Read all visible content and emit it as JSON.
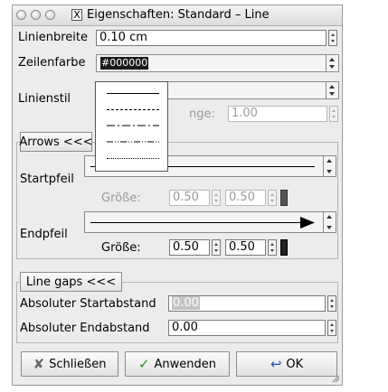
{
  "window": {
    "title": "Eigenschaften: Standard – Line",
    "window_icon_letter": "X"
  },
  "line": {
    "width_label": "Linienbreite",
    "width_value": "0.10 cm",
    "color_label": "Zeilenfarbe",
    "color_value": "#000000",
    "style_label": "Linienstil",
    "dash_length_label": "nge:",
    "dash_length_value": "1.00",
    "style_options": [
      "solid",
      "dashed",
      "dash-dot",
      "dash-dot-dot",
      "dotted"
    ]
  },
  "arrows": {
    "toggle_label": "Arrows <<<",
    "start_label": "Startpfeil",
    "start_size_label": "Größe:",
    "start_size_w": "0.50",
    "start_size_h": "0.50",
    "end_label": "Endpfeil",
    "end_size_label": "Größe:",
    "end_size_w": "0.50",
    "end_size_h": "0.50"
  },
  "gaps": {
    "toggle_label": "Line gaps <<<",
    "start_label": "Absoluter Startabstand",
    "start_value": "0.00",
    "end_label": "Absoluter Endabstand",
    "end_value": "0.00"
  },
  "buttons": {
    "close_label": "Schließen",
    "apply_label": "Anwenden",
    "ok_label": "OK"
  },
  "icons": {
    "close": "broom-icon",
    "apply": "checkmark-icon",
    "ok": "return-arrow-icon"
  }
}
